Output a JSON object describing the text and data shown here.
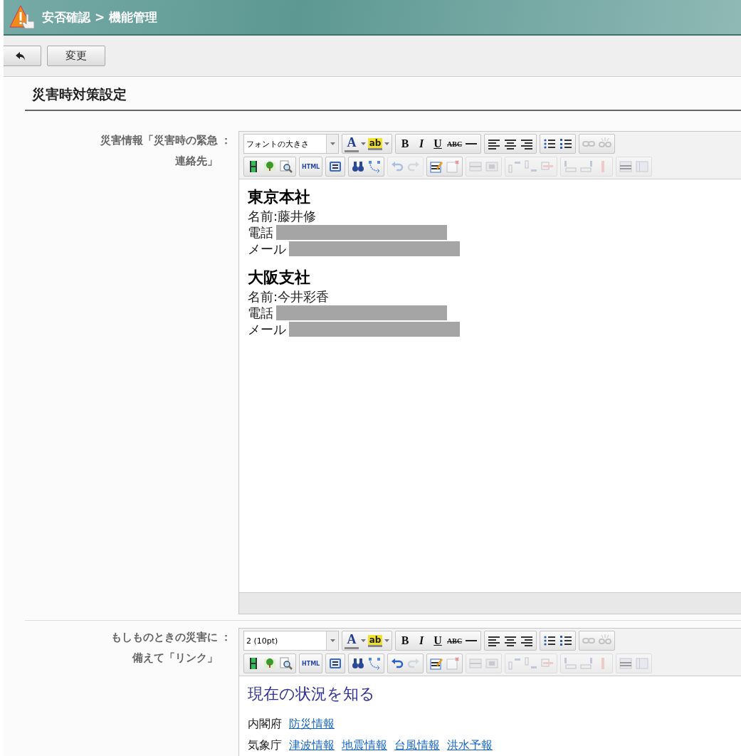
{
  "header": {
    "breadcrumb": "安否確認 > 機能管理"
  },
  "actions": [
    {
      "kind": "back"
    },
    {
      "kind": "text",
      "label": "変更"
    }
  ],
  "section_title": "災害時対策設定",
  "fields": [
    {
      "label_lines": [
        "災害情報「災害時の緊急",
        "連絡先」"
      ],
      "separator": "：",
      "editor": {
        "toolbar": {
          "font_size": "フォントの大きさ",
          "font_color": "A",
          "highlight": "ab",
          "format": [
            "B",
            "I",
            "U",
            "ABC"
          ],
          "html": "HTML",
          "undo_enabled": false
        },
        "content": {
          "kind": "contacts",
          "offices": [
            {
              "name": "東京本社",
              "lines": [
                {
                  "label": "名前:藤井修",
                  "redacted": false
                },
                {
                  "label": "電話",
                  "redacted": true
                },
                {
                  "label": "メール",
                  "redacted": true
                }
              ]
            },
            {
              "name": "大阪支社",
              "lines": [
                {
                  "label": "名前:今井彩香",
                  "redacted": false
                },
                {
                  "label": "電話",
                  "redacted": true
                },
                {
                  "label": "メール",
                  "redacted": true
                }
              ]
            }
          ]
        }
      }
    },
    {
      "label_lines": [
        "もしものときの災害に",
        "備えて「リンク」"
      ],
      "separator": "：",
      "editor": {
        "toolbar": {
          "font_size": "2 (10pt)",
          "font_color": "A",
          "highlight": "ab",
          "format": [
            "B",
            "I",
            "U",
            "ABC"
          ],
          "html": "HTML",
          "undo_enabled": true
        },
        "content": {
          "kind": "links",
          "heading": "現在の状況を知る",
          "rows": [
            {
              "source": "内閣府",
              "links": [
                "防災情報"
              ]
            },
            {
              "source": "気象庁",
              "links": [
                "津波情報",
                "地震情報",
                "台風情報",
                "洪水予報"
              ]
            }
          ]
        }
      }
    }
  ]
}
